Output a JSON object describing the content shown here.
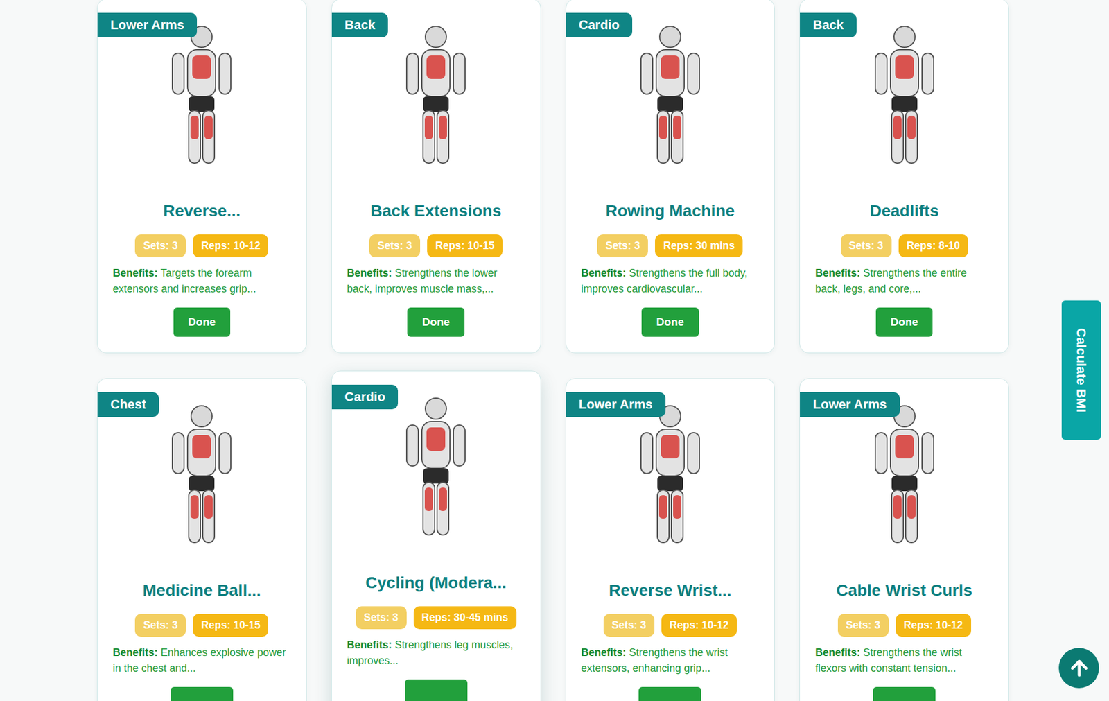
{
  "cards": [
    {
      "category": "Lower Arms",
      "title": "Reverse...",
      "sets": "Sets: 3",
      "reps": "Reps: 10-12",
      "benefits_label": "Benefits:",
      "benefits": "Targets the forearm extensors and increases grip...",
      "button": "Done",
      "raised": false
    },
    {
      "category": "Back",
      "title": "Back Extensions",
      "sets": "Sets: 3",
      "reps": "Reps: 10-15",
      "benefits_label": "Benefits:",
      "benefits": "Strengthens the lower back, improves muscle mass,...",
      "button": "Done",
      "raised": false
    },
    {
      "category": "Cardio",
      "title": "Rowing Machine",
      "sets": "Sets: 3",
      "reps": "Reps: 30 mins",
      "benefits_label": "Benefits:",
      "benefits": "Strengthens the full body, improves cardiovascular...",
      "button": "Done",
      "raised": false
    },
    {
      "category": "Back",
      "title": "Deadlifts",
      "sets": "Sets: 3",
      "reps": "Reps: 8-10",
      "benefits_label": "Benefits:",
      "benefits": "Strengthens the entire back, legs, and core,...",
      "button": "Done",
      "raised": false
    },
    {
      "category": "Chest",
      "title": "Medicine Ball...",
      "sets": "Sets: 3",
      "reps": "Reps: 10-15",
      "benefits_label": "Benefits:",
      "benefits": "Enhances explosive power in the chest and...",
      "button": null,
      "raised": false
    },
    {
      "category": "Cardio",
      "title": "Cycling (Modera...",
      "sets": "Sets: 3",
      "reps": "Reps: 30-45 mins",
      "benefits_label": "Benefits:",
      "benefits": "Strengthens leg muscles, improves...",
      "button": null,
      "raised": true
    },
    {
      "category": "Lower Arms",
      "title": "Reverse Wrist...",
      "sets": "Sets: 3",
      "reps": "Reps: 10-12",
      "benefits_label": "Benefits:",
      "benefits": "Strengthens the wrist extensors, enhancing grip...",
      "button": null,
      "raised": false
    },
    {
      "category": "Lower Arms",
      "title": "Cable Wrist Curls",
      "sets": "Sets: 3",
      "reps": "Reps: 10-12",
      "benefits_label": "Benefits:",
      "benefits": "Strengthens the wrist flexors with constant tension...",
      "button": null,
      "raised": false
    }
  ],
  "bmi_button": "Calculate BMI"
}
